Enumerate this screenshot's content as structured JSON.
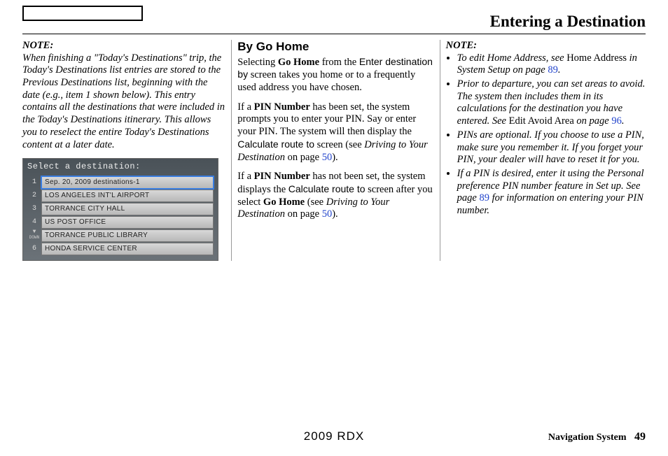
{
  "page": {
    "title": "Entering a Destination",
    "model_year": "2009  RDX",
    "footer_label": "Navigation System",
    "page_number": "49"
  },
  "col1": {
    "note_label": "NOTE:",
    "note_body": "When finishing a \"Today's Destinations\" trip, the Today's Destinations list entries are stored to the Previous Destinations list, beginning with the date (e.g., item  1 shown below). This entry contains all the destinations that were included in the Today's Destinations itinerary. This allows you to reselect the entire Today's Destinations content at a later date."
  },
  "nav_screen": {
    "header": "Select a destination:",
    "items": [
      "Sep. 20, 2009 destinations-1",
      "LOS ANGELES INT'L AIRPORT",
      "TORRANCE CITY HALL",
      "US POST OFFICE",
      "TORRANCE PUBLIC LIBRARY",
      "HONDA SERVICE CENTER"
    ],
    "down_label": "DOWN"
  },
  "col2": {
    "heading": "By Go Home",
    "p1_a": "Selecting ",
    "p1_b": "Go Home",
    "p1_c": " from the ",
    "p1_d": "Enter destination by",
    "p1_e": " screen takes you home or to a frequently used address you have chosen.",
    "p2_a": "If a ",
    "p2_b": "PIN Number",
    "p2_c": " has been set, the system prompts you to enter your PIN. Say or enter your PIN. The system will then display the ",
    "p2_d": "Calculate route to",
    "p2_e": " screen (see ",
    "p2_f": "Driving to Your Destination",
    "p2_g": " on page ",
    "p2_h": "50",
    "p2_i": ").",
    "p3_a": "If a ",
    "p3_b": "PIN Number",
    "p3_c": " has not been set, the system displays the ",
    "p3_d": "Calculate route to",
    "p3_e": " screen after you select ",
    "p3_f": "Go Home",
    "p3_g": " (see ",
    "p3_h": "Driving to Your Destination",
    "p3_i": " on page ",
    "p3_j": "50",
    "p3_k": ")."
  },
  "col3": {
    "note_label": "NOTE:",
    "b1_a": "To edit Home Address, see ",
    "b1_b": "Home Address",
    "b1_c": " in System Setup on page ",
    "b1_d": "89",
    "b1_e": ".",
    "b2_a": "Prior to departure, you can set areas to avoid. The system then includes them in its calculations for the destination you have entered. See ",
    "b2_b": "Edit Avoid Area",
    "b2_c": " on page ",
    "b2_d": "96",
    "b2_e": ".",
    "b3": "PINs are optional. If you choose to use a PIN, make sure you remember it. If you forget your PIN, your dealer will have to reset it for you.",
    "b4_a": "If a PIN is desired, enter it using the Personal preference PIN number feature in Set up. See page ",
    "b4_b": "89",
    "b4_c": " for information on entering your PIN number."
  }
}
